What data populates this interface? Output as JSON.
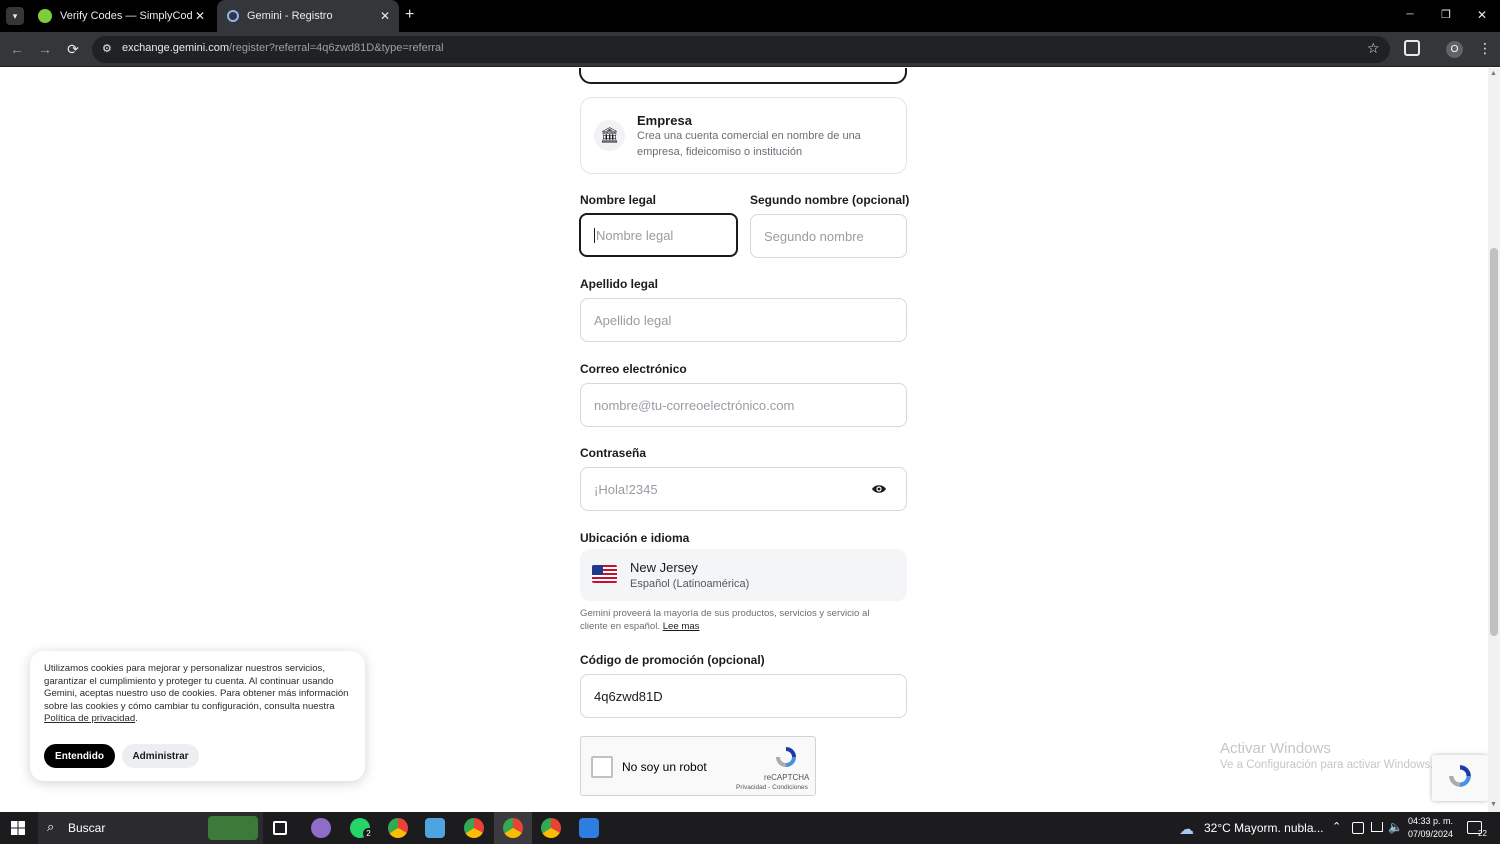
{
  "browser": {
    "tabs": [
      {
        "title": "Verify Codes — SimplyCodes",
        "close": "✕"
      },
      {
        "title": "Gemini - Registro",
        "close": "✕"
      }
    ],
    "new_tab": "+",
    "window": {
      "minimize": "─",
      "restore": "❐",
      "close": "✕"
    },
    "url_host": "exchange.gemini.com",
    "url_path": "/register?referral=4q6zwd81D&type=referral",
    "profile_initial": "O"
  },
  "form": {
    "business": {
      "title": "Empresa",
      "desc_line1": "Crea una cuenta comercial en nombre de una",
      "desc_line2": "empresa, fideicomiso o institución"
    },
    "legal_name": {
      "label": "Nombre legal",
      "placeholder": "Nombre legal"
    },
    "middle_name": {
      "label": "Segundo nombre (opcional)",
      "placeholder": "Segundo nombre"
    },
    "last_name": {
      "label": "Apellido legal",
      "placeholder": "Apellido legal"
    },
    "email": {
      "label": "Correo electrónico",
      "placeholder": "nombre@tu-correoelectrónico.com"
    },
    "password": {
      "label": "Contraseña",
      "placeholder": "¡Hola!2345"
    },
    "location": {
      "label": "Ubicación e idioma",
      "region": "New Jersey",
      "language": "Español (Latinoamérica)",
      "note_line1": "Gemini proveerá la mayoría de sus productos, servicios y servicio al",
      "note_line2": "cliente en español.",
      "note_link": "Lee mas"
    },
    "promo": {
      "label": "Código de promoción (opcional)",
      "value": "4q6zwd81D"
    },
    "captcha": {
      "label": "No soy un robot",
      "brand": "reCAPTCHA",
      "links": "Privacidad - Condiciones"
    }
  },
  "cookie": {
    "text": "Utilizamos cookies para mejorar y personalizar nuestros servicios, garantizar el cumplimiento y proteger tu cuenta. Al continuar usando Gemini, aceptas nuestro uso de cookies. Para obtener más información sobre las cookies y cómo cambiar tu configuración, consulta nuestra",
    "link": "Política de privacidad",
    "accept": "Entendido",
    "manage": "Administrar"
  },
  "watermark": {
    "line1": "Activar Windows",
    "line2": "Ve a Configuración para activar Windows."
  },
  "taskbar": {
    "search": "Buscar",
    "weather": "32°C  Mayorm. nubla...",
    "time": "04:33 p. m.",
    "date": "07/09/2024",
    "notifications": "22",
    "whatsapp_badge": "2"
  },
  "colors": {
    "accent": "#1b1b1f",
    "chrome_dark": "#35363a",
    "focus_border": "#1b1b1f"
  }
}
